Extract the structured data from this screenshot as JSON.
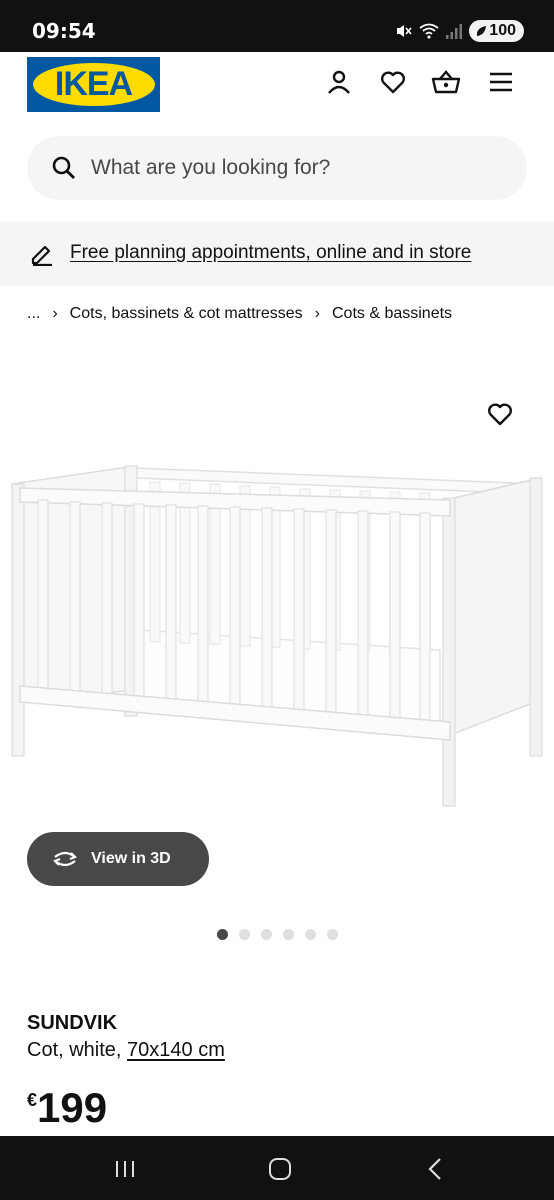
{
  "status_bar": {
    "time": "09:54",
    "battery": "100"
  },
  "header": {
    "logo_text": "IKEA",
    "brand_colors": {
      "blue": "#0058a3",
      "yellow": "#ffdb00"
    }
  },
  "icons": {
    "account": "person-icon",
    "wishlist": "heart-icon",
    "cart": "basket-icon",
    "menu": "hamburger-icon",
    "search": "search-icon",
    "promo": "pencil-icon",
    "view3d": "rotate-icon"
  },
  "search": {
    "placeholder": "What are you looking for?"
  },
  "promo": {
    "text": "Free planning appointments, online and in store"
  },
  "breadcrumb": {
    "items": [
      "...",
      "Cots, bassinets & cot mattresses",
      "Cots & bassinets"
    ]
  },
  "product": {
    "view3d_label": "View in 3D",
    "image_count": 6,
    "active_image": 1,
    "name": "SUNDVIK",
    "description": "Cot, white, ",
    "size": "70x140 cm",
    "currency": "€",
    "price": "199"
  }
}
